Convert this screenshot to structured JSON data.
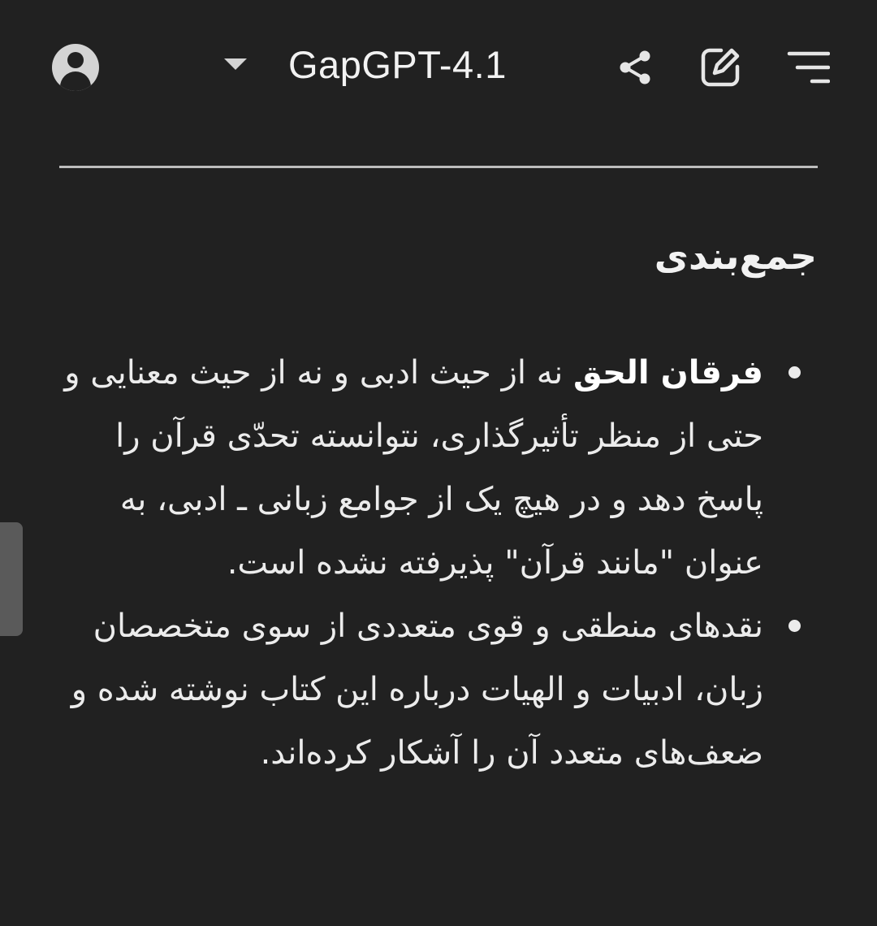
{
  "header": {
    "model_name": "GapGPT-4.1",
    "icons": {
      "avatar": "user-avatar-icon",
      "model_dropdown": "chevron-down-icon",
      "share": "share-icon",
      "edit": "new-chat-edit-icon",
      "menu": "menu-icon"
    }
  },
  "content": {
    "section_title": "جمع‌بندی",
    "bullets": [
      {
        "strong": "فرقان الحق",
        "text": " نه از حیث ادبی و نه از حیث معنایی و حتی از منظر تأثیرگذاری، نتوانسته تحدّی قرآن را پاسخ دهد و در هیچ یک از جوامع زبانی ـ ادبی، به عنوان \"مانند قرآن\" پذیرفته نشده است."
      },
      {
        "strong": "",
        "text": "نقدهای منطقی و قوی متعددی از سوی متخصصان زبان، ادبیات و الهیات درباره این کتاب نوشته شده و ضعف‌های متعدد آن را آشکار کرده‌اند."
      }
    ]
  },
  "colors": {
    "background": "#212121",
    "text": "#ececec",
    "divider": "#bdbdbd"
  }
}
